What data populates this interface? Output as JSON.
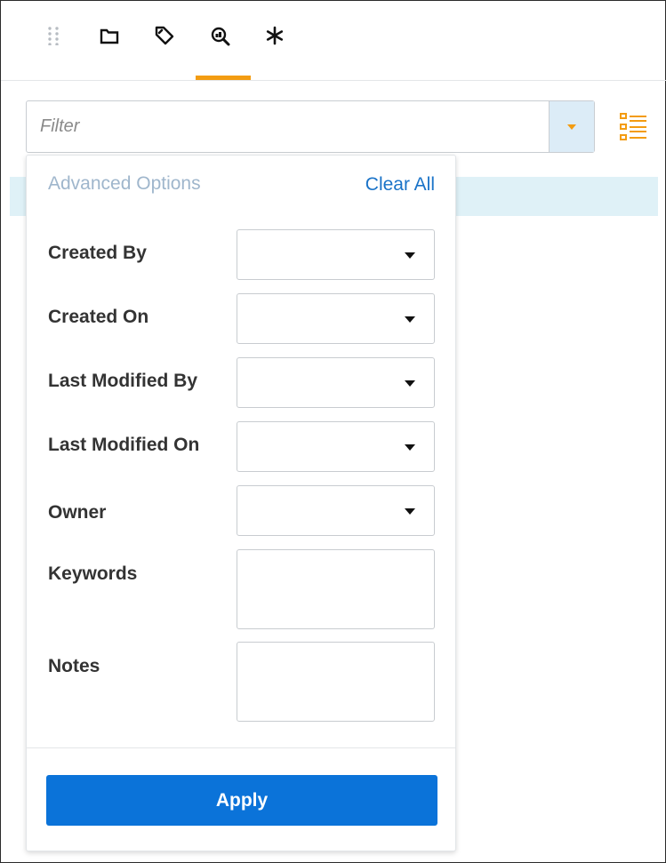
{
  "toolbar": {
    "icons": [
      "drag-handle-icon",
      "folder-icon",
      "tag-icon",
      "search-document-icon",
      "asterisk-icon"
    ],
    "active_tab_color": "#f39c12"
  },
  "filter": {
    "placeholder": "Filter",
    "value": ""
  },
  "advanced": {
    "title": "Advanced Options",
    "clear_all": "Clear All",
    "fields": {
      "created_by": "Created By",
      "created_on": "Created On",
      "last_modified_by": "Last Modified By",
      "last_modified_on": "Last Modified On",
      "owner": "Owner",
      "keywords": "Keywords",
      "notes": "Notes"
    },
    "apply": "Apply"
  },
  "colors": {
    "accent": "#f39c12",
    "primary": "#0b73d9",
    "link": "#1a73c8",
    "highlight": "#dff1f7"
  }
}
